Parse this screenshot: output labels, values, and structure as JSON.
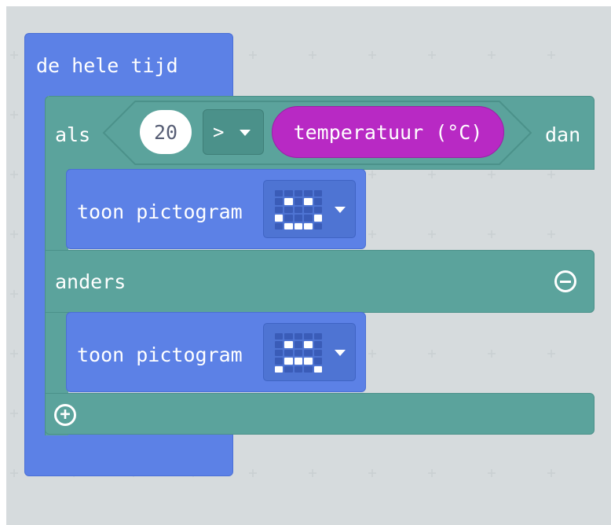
{
  "workspace": {
    "forever_label": "de hele tijd",
    "if_label": "als",
    "then_label": "dan",
    "else_label": "anders",
    "compare": {
      "left_value": "20",
      "operator": ">",
      "right_block": "temperatuur (°C)"
    },
    "show_blocks": [
      {
        "label": "toon pictogram",
        "icon": "happy-face-icon",
        "pattern": [
          [
            0,
            0,
            0,
            0,
            0
          ],
          [
            0,
            1,
            0,
            1,
            0
          ],
          [
            0,
            0,
            0,
            0,
            0
          ],
          [
            1,
            0,
            0,
            0,
            1
          ],
          [
            0,
            1,
            1,
            1,
            0
          ]
        ]
      },
      {
        "label": "toon pictogram",
        "icon": "sad-face-icon",
        "pattern": [
          [
            0,
            0,
            0,
            0,
            0
          ],
          [
            0,
            1,
            0,
            1,
            0
          ],
          [
            0,
            0,
            0,
            0,
            0
          ],
          [
            0,
            1,
            1,
            1,
            0
          ],
          [
            1,
            0,
            0,
            0,
            1
          ]
        ]
      }
    ],
    "remove_else_icon": "minus-circle-icon",
    "add_branch_icon": "plus-circle-icon"
  },
  "colors": {
    "loop": "#5c81e6",
    "logic": "#5ba39c",
    "input": "#b829c4",
    "background": "#ecf0f1"
  }
}
